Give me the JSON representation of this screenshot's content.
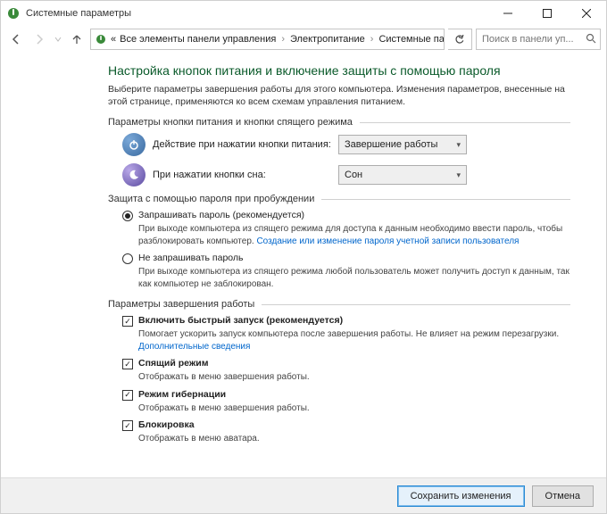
{
  "titlebar": {
    "title": "Системные параметры"
  },
  "nav": {
    "crumb1": "Все элементы панели управления",
    "crumb2": "Электропитание",
    "crumb3": "Системные параметры",
    "search_placeholder": "Поиск в панели уп..."
  },
  "page": {
    "heading": "Настройка кнопок питания и включение защиты с помощью пароля",
    "intro": "Выберите параметры завершения работы для этого компьютера. Изменения параметров, внесенные на этой странице, применяются ко всем схемам управления питанием."
  },
  "group_buttons": {
    "legend": "Параметры кнопки питания и кнопки спящего режима",
    "power_label": "Действие при нажатии кнопки питания:",
    "power_value": "Завершение работы",
    "sleep_label": "При нажатии кнопки сна:",
    "sleep_value": "Сон"
  },
  "group_password": {
    "legend": "Защита с помощью пароля при пробуждении",
    "opt1_label": "Запрашивать пароль (рекомендуется)",
    "opt1_desc": "При выходе компьютера из спящего режима для доступа к данным необходимо ввести пароль, чтобы разблокировать компьютер. ",
    "opt1_link": "Создание или изменение пароля учетной записи пользователя",
    "opt2_label": "Не запрашивать пароль",
    "opt2_desc": "При выходе компьютера из спящего режима любой пользователь может получить доступ к данным, так как компьютер не заблокирован."
  },
  "group_shutdown": {
    "legend": "Параметры завершения работы",
    "c1_label": "Включить быстрый запуск (рекомендуется)",
    "c1_desc": "Помогает ускорить запуск компьютера после завершения работы. Не влияет на режим перезагрузки. ",
    "c1_link": "Дополнительные сведения",
    "c2_label": "Спящий режим",
    "c2_desc": "Отображать в меню завершения работы.",
    "c3_label": "Режим гибернации",
    "c3_desc": "Отображать в меню завершения работы.",
    "c4_label": "Блокировка",
    "c4_desc": "Отображать в меню аватара."
  },
  "footer": {
    "save": "Сохранить изменения",
    "cancel": "Отмена"
  }
}
